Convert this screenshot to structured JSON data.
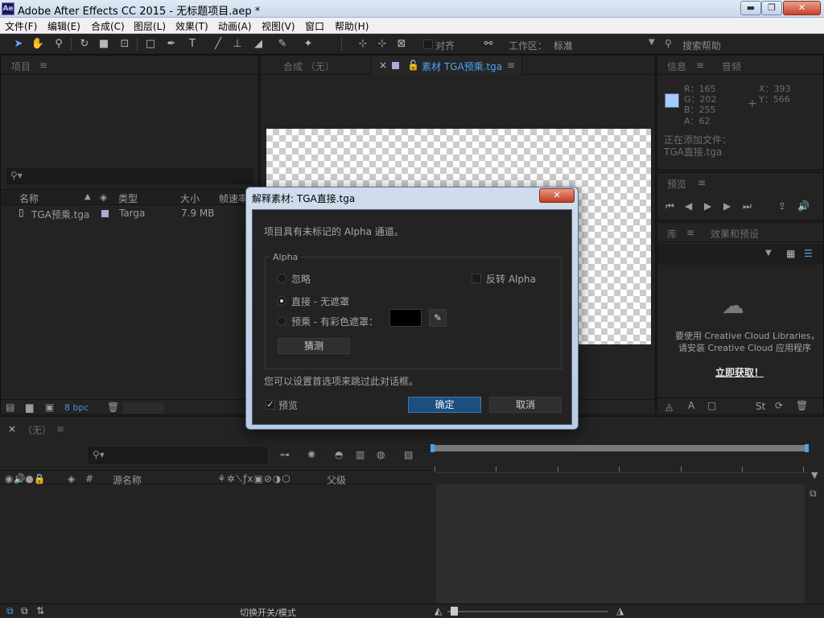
{
  "window": {
    "title": "Adobe After Effects CC 2015 - 无标题项目.aep *",
    "logo_text": "Ae",
    "minimize_glyph": "▬",
    "maximize_glyph": "❐",
    "close_glyph": "✕"
  },
  "menu": {
    "items": [
      "文件(F)",
      "编辑(E)",
      "合成(C)",
      "图层(L)",
      "效果(T)",
      "动画(A)",
      "视图(V)",
      "窗口",
      "帮助(H)"
    ]
  },
  "toolbar": {
    "snap_label": "对齐",
    "workspace_label": "工作区：",
    "workspace_value": "标准",
    "search_help_placeholder": "搜索帮助"
  },
  "project_panel": {
    "tab_label": "项目",
    "search_placeholder": "",
    "columns": {
      "name": "名称",
      "type": "类型",
      "size": "大小",
      "fps": "帧速率"
    },
    "rows": [
      {
        "name": "TGA预乘.tga",
        "type": "Targa",
        "size": "7.9 MB"
      }
    ],
    "bpc_label": "8 bpc"
  },
  "viewer": {
    "comp_tab_label": "合成 （无）",
    "footage_tab_label": "素材 TGA预乘.tga"
  },
  "info_panel": {
    "tab_info": "信息",
    "tab_audio": "音频",
    "r": "R：165",
    "g": "G：202",
    "b": "B：255",
    "a": "A：62",
    "x": "X：393",
    "y": "Y：566",
    "adding_label": "正在添加文件：",
    "adding_file": "TGA直接.tga",
    "swatch_color": "#a5caff"
  },
  "preview_panel": {
    "tab_label": "预览"
  },
  "library_panel": {
    "tab_library": "库",
    "tab_effects": "效果和预设",
    "message_line1": "要使用 Creative Cloud Libraries，",
    "message_line2": "请安装 Creative Cloud 应用程序",
    "get_now_link": "立即获取！"
  },
  "dialog": {
    "title": "解释素材: TGA直接.tga",
    "message": "项目具有未标记的 Alpha 通道。",
    "group_label": "Alpha",
    "option_ignore": "忽略",
    "option_straight": "直接 - 无遮罩",
    "option_premultiplied": "预乘 - 有彩色遮罩：",
    "invert_label": "反转 Alpha",
    "guess_button": "猜测",
    "hint": "您可以设置首选项来跳过此对话框。",
    "preview_label": "预览",
    "ok_button": "确定",
    "cancel_button": "取消",
    "matte_color": "#000000"
  },
  "timeline": {
    "tab_label": "（无）",
    "source_name_col": "源名称",
    "parent_col": "父级",
    "hash_col": "#",
    "toggle_label": "切换开关/模式"
  }
}
